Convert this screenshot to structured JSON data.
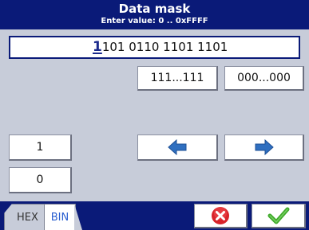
{
  "header": {
    "title": "Data mask",
    "subtitle": "Enter value: 0 .. 0xFFFF"
  },
  "value_field": {
    "cursor_digit": "1",
    "rest": "101 0110 1101 1101"
  },
  "buttons": {
    "all_ones_label": "111...111",
    "all_zeros_label": "000...000",
    "one_label": "1",
    "zero_label": "0",
    "left_icon": "arrow-left-icon",
    "right_icon": "arrow-right-icon",
    "cancel_icon": "cancel-icon",
    "ok_icon": "ok-icon"
  },
  "tabs": [
    {
      "label": "HEX",
      "active": false
    },
    {
      "label": "BIN",
      "active": true
    }
  ],
  "colors": {
    "header_bg": "#0a1a78",
    "panel_bg": "#c7ccd9",
    "arrow_blue": "#2f6fc0",
    "cancel_red": "#d8232a",
    "ok_green": "#3fa92a"
  }
}
